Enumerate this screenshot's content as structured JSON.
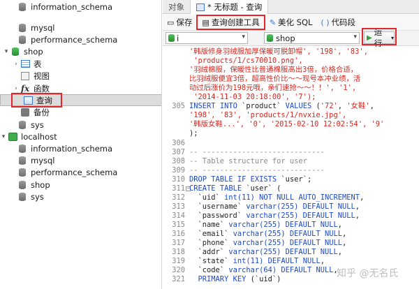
{
  "tree": {
    "items": [
      {
        "label": "information_schema",
        "icon": "database-icon"
      },
      {
        "label": "mysql",
        "icon": "database-icon"
      },
      {
        "label": "performance_schema",
        "icon": "database-icon"
      },
      {
        "label": "shop",
        "icon": "database-icon"
      },
      {
        "label": "表",
        "icon": "table-icon"
      },
      {
        "label": "视图",
        "icon": "view-icon"
      },
      {
        "label": "函数",
        "icon": "function-icon"
      },
      {
        "label": "查询",
        "icon": "query-icon"
      },
      {
        "label": "备份",
        "icon": "backup-icon"
      },
      {
        "label": "sys",
        "icon": "database-icon"
      },
      {
        "label": "localhost",
        "icon": "server-icon"
      },
      {
        "label": "information_schema",
        "icon": "database-icon"
      },
      {
        "label": "mysql",
        "icon": "database-icon"
      },
      {
        "label": "performance_schema",
        "icon": "database-icon"
      },
      {
        "label": "shop",
        "icon": "database-icon"
      },
      {
        "label": "sys",
        "icon": "database-icon"
      }
    ]
  },
  "tabs": {
    "objects": "对象",
    "query_tab": "* 无标题 - 查询"
  },
  "toolbar": {
    "save": "保存",
    "query_builder": "查询创建工具",
    "beautify": "美化 SQL",
    "snippet": "代码段"
  },
  "selectors": {
    "connection": "i",
    "database": "shop",
    "run": "运行"
  },
  "editor": {
    "lines": [
      {
        "n": "",
        "text": "'韩版修身羽绒服加厚保暖可脱卸帽', '198', '83',",
        "cls": "str"
      },
      {
        "n": "",
        "text": " 'products/1/cs70010.png',",
        "cls": "str"
      },
      {
        "n": "",
        "text": "'羽绒棉服，保暖性比普通棉服高出3倍，价格合适，",
        "cls": "str"
      },
      {
        "n": "",
        "text": "比羽绒服便宜3倍，超高性价比～～现号本冲业绩，活",
        "cls": "str"
      },
      {
        "n": "",
        "text": "动过后涨价为198元哦，亲们速抢～～！！', '1',",
        "cls": "str"
      },
      {
        "n": "",
        "text": " '2014-11-03 20:18:00', '7');",
        "cls": "str"
      },
      {
        "n": "305",
        "text": "INSERT INTO `product` VALUES ('72', '女鞋',",
        "cls": "mix1"
      },
      {
        "n": "",
        "text": "'198', '83', 'products/1/nvxie.jpg',",
        "cls": "str"
      },
      {
        "n": "",
        "text": "'韩版女鞋...', '0', '2015-02-10 12:02:54', '9'",
        "cls": "str"
      },
      {
        "n": "",
        "text": ");",
        "cls": "tx"
      },
      {
        "n": "306",
        "text": "",
        "cls": "tx"
      },
      {
        "n": "307",
        "text": "-- ----------------------------",
        "cls": "cm"
      },
      {
        "n": "308",
        "text": "-- Table structure for user",
        "cls": "cm"
      },
      {
        "n": "309",
        "text": "-- ----------------------------",
        "cls": "cm"
      },
      {
        "n": "310",
        "text": "DROP TABLE IF EXISTS `user`;",
        "cls": "mix2"
      },
      {
        "n": "311",
        "text": "CREATE TABLE `user` (",
        "cls": "mix3"
      },
      {
        "n": "312",
        "text": "  `uid` int(11) NOT NULL AUTO_INCREMENT,",
        "cls": "mix4"
      },
      {
        "n": "313",
        "text": "  `username` varchar(255) DEFAULT NULL,",
        "cls": "mix5"
      },
      {
        "n": "314",
        "text": "  `password` varchar(255) DEFAULT NULL,",
        "cls": "mix5"
      },
      {
        "n": "315",
        "text": "  `name` varchar(255) DEFAULT NULL,",
        "cls": "mix5"
      },
      {
        "n": "316",
        "text": "  `email` varchar(255) DEFAULT NULL,",
        "cls": "mix5"
      },
      {
        "n": "317",
        "text": "  `phone` varchar(255) DEFAULT NULL,",
        "cls": "mix5"
      },
      {
        "n": "318",
        "text": "  `addr` varchar(255) DEFAULT NULL,",
        "cls": "mix5"
      },
      {
        "n": "319",
        "text": "  `state` int(11) DEFAULT NULL,",
        "cls": "mix5"
      },
      {
        "n": "320",
        "text": "  `code` varchar(64) DEFAULT NULL,",
        "cls": "mix5"
      },
      {
        "n": "321",
        "text": "  PRIMARY KEY (`uid`)",
        "cls": "mix6"
      }
    ]
  },
  "watermark": "知乎 @无名氏",
  "colors": {
    "highlight_border": "#e3262b",
    "keyword": "#1d49c9",
    "string": "#d8261f",
    "comment": "#8a8a8a",
    "run_icon": "#2fa33c"
  }
}
